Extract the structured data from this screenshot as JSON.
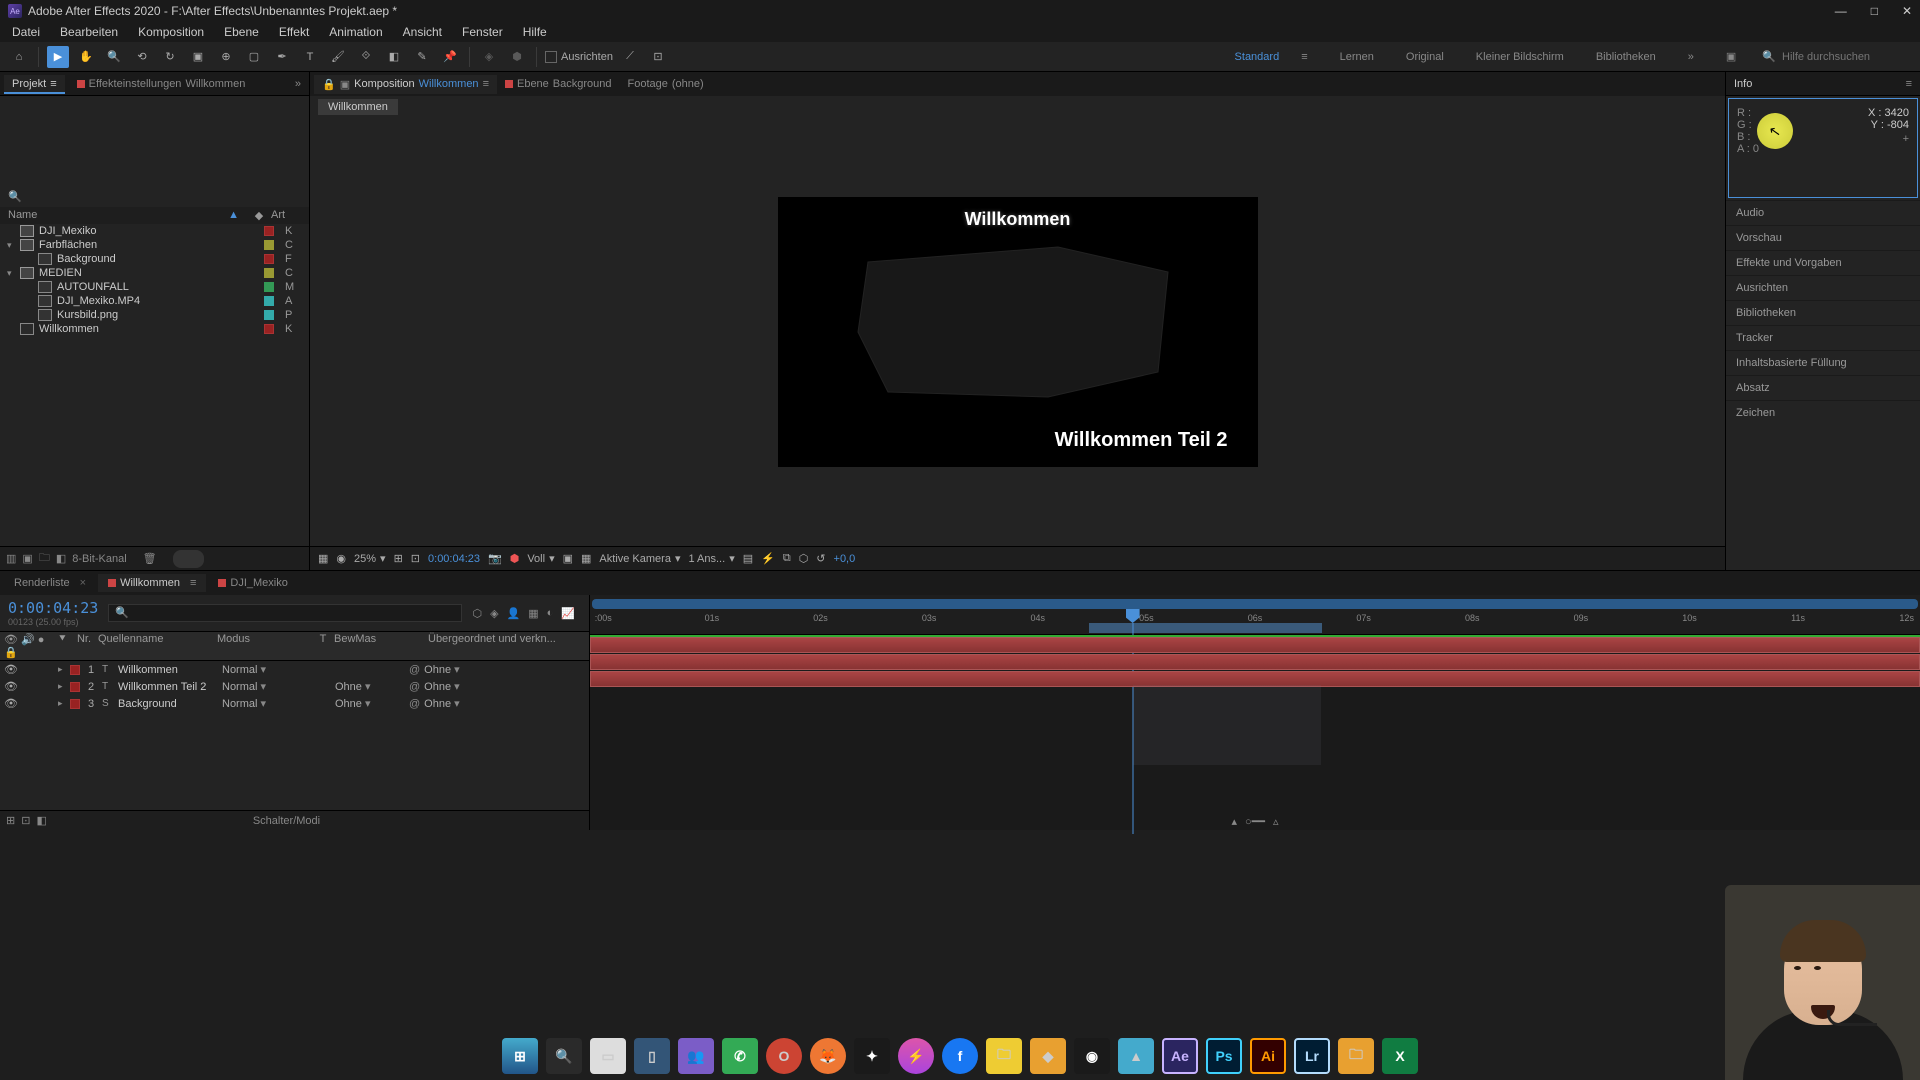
{
  "title": "Adobe After Effects 2020 - F:\\After Effects\\Unbenanntes Projekt.aep *",
  "menu": [
    "Datei",
    "Bearbeiten",
    "Komposition",
    "Ebene",
    "Effekt",
    "Animation",
    "Ansicht",
    "Fenster",
    "Hilfe"
  ],
  "toolbar": {
    "align_label": "Ausrichten"
  },
  "workspaces": [
    "Standard",
    "Lernen",
    "Original",
    "Kleiner Bildschirm",
    "Bibliotheken"
  ],
  "search_help_placeholder": "Hilfe durchsuchen",
  "left_tabs": {
    "project": "Projekt",
    "effect_settings_prefix": "Effekteinstellungen",
    "effect_settings_name": "Willkommen"
  },
  "project": {
    "columns": {
      "name": "Name",
      "label_col": "",
      "art": "Art"
    },
    "items": [
      {
        "name": "DJI_Mexiko",
        "kind": "folder",
        "twirl": "none",
        "indent": 0,
        "label": "red",
        "type": "K"
      },
      {
        "name": "Farbflächen",
        "kind": "folder",
        "twirl": "open",
        "indent": 0,
        "label": "yellow",
        "type": "C"
      },
      {
        "name": "Background",
        "kind": "solid",
        "twirl": "none",
        "indent": 1,
        "label": "red",
        "type": "F"
      },
      {
        "name": "MEDIEN",
        "kind": "folder",
        "twirl": "open",
        "indent": 0,
        "label": "yellow",
        "type": "C"
      },
      {
        "name": "AUTOUNFALL",
        "kind": "footage",
        "twirl": "none",
        "indent": 1,
        "label": "green",
        "type": "M"
      },
      {
        "name": "DJI_Mexiko.MP4",
        "kind": "video",
        "twirl": "none",
        "indent": 1,
        "label": "cyan",
        "type": "A"
      },
      {
        "name": "Kursbild.png",
        "kind": "image",
        "twirl": "none",
        "indent": 1,
        "label": "cyan",
        "type": "P"
      },
      {
        "name": "Willkommen",
        "kind": "comp",
        "twirl": "none",
        "indent": 0,
        "label": "red",
        "type": "K"
      }
    ],
    "footer_bit": "8-Bit-Kanal"
  },
  "comp_tabs": [
    {
      "prefix": "Komposition",
      "name": "Willkommen",
      "active": true
    },
    {
      "prefix": "Ebene",
      "name": "Background",
      "active": false
    },
    {
      "prefix": "Footage",
      "name": "(ohne)",
      "active": false
    }
  ],
  "breadcrumb": "Willkommen",
  "canvas": {
    "title": "Willkommen",
    "subtitle": "Willkommen Teil 2"
  },
  "viewer_footer": {
    "zoom": "25%",
    "time": "0:00:04:23",
    "res": "Voll",
    "camera": "Aktive Kamera",
    "views": "1 Ans...",
    "exposure": "+0,0"
  },
  "info_panel": {
    "title": "Info",
    "r": "R :",
    "g": "G :",
    "b": "B :",
    "a_label": "A :",
    "a_val": "0",
    "x_label": "X :",
    "x_val": "3420",
    "y_label": "Y :",
    "y_val": "-804"
  },
  "right_sections": [
    "Audio",
    "Vorschau",
    "Effekte und Vorgaben",
    "Ausrichten",
    "Bibliotheken",
    "Tracker",
    "Inhaltsbasierte Füllung",
    "Absatz",
    "Zeichen"
  ],
  "timeline": {
    "tabs": [
      "Renderliste",
      "Willkommen",
      "DJI_Mexiko"
    ],
    "active_tab": 1,
    "timecode": "0:00:04:23",
    "timecode_sub": "00123 (25.00 fps)",
    "columns": {
      "nr": "Nr.",
      "source": "Quellenname",
      "mode": "Modus",
      "t": "T",
      "bew": "BewMas",
      "parent": "Übergeordnet und verkn..."
    },
    "rows": [
      {
        "num": "1",
        "name": "Willkommen",
        "mode": "Normal",
        "bew": "",
        "parent": "Ohne",
        "type": "T",
        "label": "red"
      },
      {
        "num": "2",
        "name": "Willkommen Teil 2",
        "mode": "Normal",
        "bew": "Ohne",
        "parent": "Ohne",
        "type": "T",
        "label": "red"
      },
      {
        "num": "3",
        "name": "Background",
        "mode": "Normal",
        "bew": "Ohne",
        "parent": "Ohne",
        "type": "S",
        "label": "red"
      }
    ],
    "footer": "Schalter/Modi",
    "ruler_marks": [
      ":00s",
      "01s",
      "02s",
      "03s",
      "04s",
      "05s",
      "06s",
      "07s",
      "08s",
      "09s",
      "10s",
      "11s",
      "12s"
    ]
  }
}
